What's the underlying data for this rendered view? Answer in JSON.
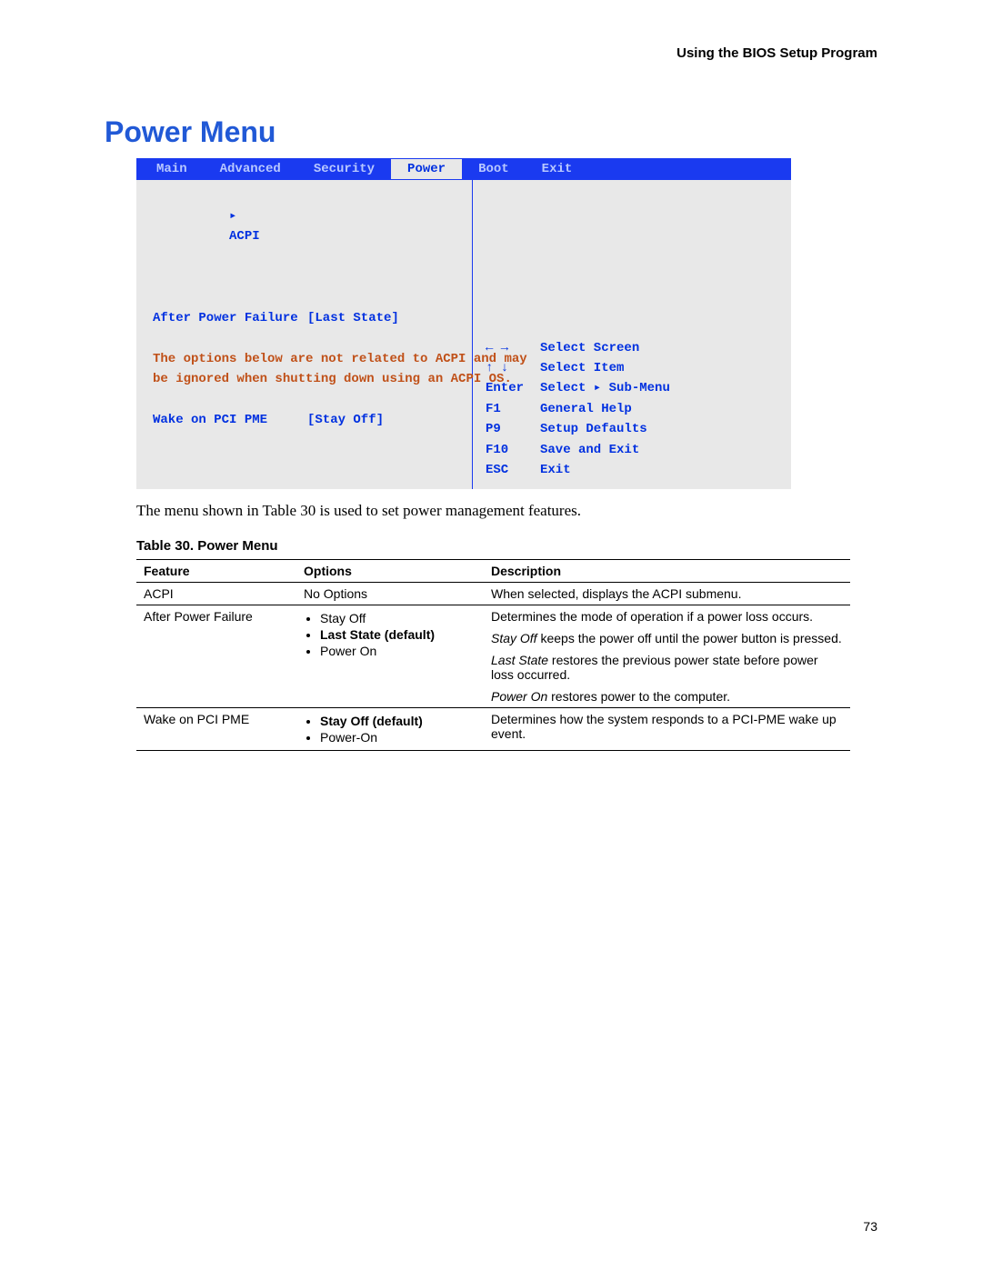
{
  "header": {
    "title": "Using the BIOS Setup Program"
  },
  "page_title": "Power Menu",
  "bios": {
    "tabs": [
      "Main",
      "Advanced",
      "Security",
      "Power",
      "Boot",
      "Exit"
    ],
    "active_tab": "Power",
    "submenu_marker": "▸",
    "submenu_label": "ACPI",
    "fields": [
      {
        "label": "After Power Failure",
        "value": "[Last State]"
      }
    ],
    "note1": "The options below are not related to ACPI and may",
    "note2": "be ignored when shutting down using an ACPI OS.",
    "fields2": [
      {
        "label": "Wake on PCI PME",
        "value": "[Stay Off]"
      }
    ],
    "help": [
      {
        "key": "← →",
        "text": "Select Screen"
      },
      {
        "key": "↑ ↓",
        "text": "Select Item"
      },
      {
        "key": "Enter",
        "text": "Select ▸ Sub-Menu"
      },
      {
        "key": "F1",
        "text": "General Help"
      },
      {
        "key": "P9",
        "text": "Setup Defaults"
      },
      {
        "key": "F10",
        "text": "Save and Exit"
      },
      {
        "key": "ESC",
        "text": "Exit"
      }
    ]
  },
  "caption_text": "The menu shown in Table 30 is used to set power management features.",
  "table": {
    "caption": "Table 30.   Power Menu",
    "headers": [
      "Feature",
      "Options",
      "Description"
    ],
    "rows": {
      "r0": {
        "feature": "ACPI",
        "options_text": "No Options",
        "description": "When selected, displays the ACPI submenu."
      },
      "r1": {
        "feature": "After Power Failure",
        "opt0": "Stay Off",
        "opt1": "Last State (default)",
        "opt2": "Power On",
        "desc_line0": "Determines the mode of operation if a power loss occurs.",
        "stayoff_i": "Stay Off",
        "stayoff_r": " keeps the power off until the power button is pressed.",
        "laststate_i": "Last State",
        "laststate_r": " restores the previous power state before power loss occurred.",
        "poweron_i": "Power On",
        "poweron_r": " restores power to the computer."
      },
      "r2": {
        "feature": "Wake on PCI PME",
        "opt0": "Stay Off (default)",
        "opt1": "Power-On",
        "description": "Determines how the system responds to a PCI-PME wake up event."
      }
    }
  },
  "page_number": "73"
}
